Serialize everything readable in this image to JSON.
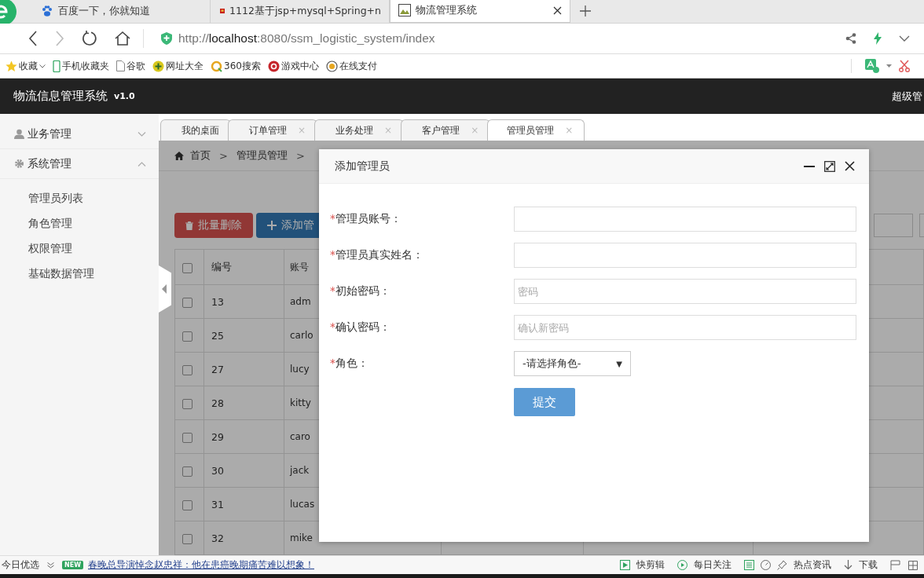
{
  "browser": {
    "tabs": [
      {
        "title": "百度一下，你就知道",
        "selected": false
      },
      {
        "title": "1112基于jsp+mysql+Spring+n",
        "selected": false
      },
      {
        "title": "物流管理系统",
        "selected": true
      }
    ],
    "url": "http://**localhost**:8080/ssm_logistic_system/index",
    "bookmarks": [
      "收藏",
      "手机收藏夹",
      "谷歌",
      "网址大全",
      "360搜索",
      "游戏中心",
      "在线支付"
    ]
  },
  "app": {
    "title": "物流信息管理系统",
    "version": "v1.0",
    "user": "超级管"
  },
  "sidebar": {
    "items": [
      {
        "label": "业务管理",
        "expanded": false
      },
      {
        "label": "系统管理",
        "expanded": true,
        "children": [
          {
            "label": "管理员列表"
          },
          {
            "label": "角色管理"
          },
          {
            "label": "权限管理"
          },
          {
            "label": "基础数据管理"
          }
        ]
      }
    ]
  },
  "tabs": [
    {
      "label": "我的桌面",
      "selected": false
    },
    {
      "label": "订单管理",
      "close": "×",
      "selected": false
    },
    {
      "label": "业务处理",
      "close": "×",
      "selected": false
    },
    {
      "label": "客户管理",
      "close": "×",
      "selected": false
    },
    {
      "label": "管理员管理",
      "close": "×",
      "selected": true
    }
  ],
  "breadcrumb": [
    "首页",
    "管理员管理"
  ],
  "breadcrumb_separator": ">",
  "actions": [
    "批量删除",
    "添加管"
  ],
  "table": {
    "all_checked": false,
    "columns": [
      "编号",
      "账号"
    ],
    "rows": [
      {
        "checked": false,
        "cells": [
          "13",
          "adm"
        ]
      },
      {
        "checked": false,
        "cells": [
          "25",
          "carlo"
        ]
      },
      {
        "checked": false,
        "cells": [
          "27",
          "lucy"
        ]
      },
      {
        "checked": false,
        "cells": [
          "28",
          "kitty"
        ]
      },
      {
        "checked": false,
        "cells": [
          "29",
          "caro"
        ]
      },
      {
        "checked": false,
        "cells": [
          "30",
          "jack"
        ]
      },
      {
        "checked": false,
        "cells": [
          "31",
          "lucas"
        ]
      },
      {
        "checked": false,
        "cells": [
          "32",
          "mike"
        ]
      }
    ]
  },
  "dialog": {
    "title": "添加管理员",
    "fields": [
      {
        "kind": "text",
        "mark": "*",
        "label": "管理员账号："
      },
      {
        "kind": "text",
        "mark": "*",
        "label": "管理员真实姓名："
      },
      {
        "kind": "text",
        "mark": "*",
        "label": "初始密码：",
        "placeholder": "密码"
      },
      {
        "kind": "text",
        "mark": "*",
        "label": "确认密码：",
        "placeholder": "确认新密码"
      },
      {
        "kind": "select",
        "mark": "*",
        "label": "角色：",
        "value": "-请选择角色-",
        "caret": "▼"
      }
    ],
    "submit": "提交"
  },
  "status_bar": {
    "left": "今日优选",
    "badge": "NEW",
    "headline": "春晚总导演悼念赵忠祥：他在患癌晚期痛苦难以想象！",
    "items": [
      "快剪辑",
      "每日关注",
      "热点资讯",
      "下载"
    ]
  }
}
